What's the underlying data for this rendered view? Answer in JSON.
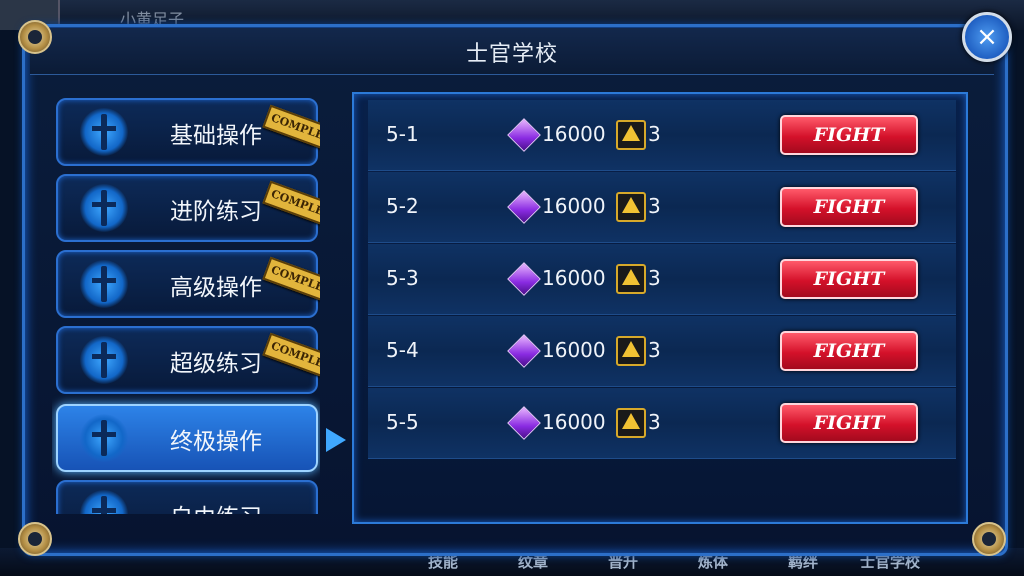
{
  "window": {
    "title": "士官学校"
  },
  "topbar": {
    "name": "小黄足子"
  },
  "categories": [
    {
      "label": "基础操作",
      "badge": "COMPLETE"
    },
    {
      "label": "进阶练习",
      "badge": "COMPLETE"
    },
    {
      "label": "高级操作",
      "badge": "COMPLETE"
    },
    {
      "label": "超级练习",
      "badge": "COMPLETE"
    },
    {
      "label": "终极操作",
      "badge": ""
    },
    {
      "label": "自由练习",
      "badge": ""
    }
  ],
  "stages": [
    {
      "id": "5-1",
      "cost": "16000",
      "stamina": "3",
      "button": "FIGHT"
    },
    {
      "id": "5-2",
      "cost": "16000",
      "stamina": "3",
      "button": "FIGHT"
    },
    {
      "id": "5-3",
      "cost": "16000",
      "stamina": "3",
      "button": "FIGHT"
    },
    {
      "id": "5-4",
      "cost": "16000",
      "stamina": "3",
      "button": "FIGHT"
    },
    {
      "id": "5-5",
      "cost": "16000",
      "stamina": "3",
      "button": "FIGHT"
    }
  ],
  "bottom_tabs": [
    "技能",
    "纹章",
    "晋升",
    "炼体",
    "羁绊",
    "士官学校"
  ],
  "icons": {
    "close": "close-icon",
    "crystal": "crystal-icon",
    "stamina": "stamina-icon",
    "arrow": "selected-arrow-icon"
  },
  "colors": {
    "accent": "#2c7ad8",
    "fight": "#d4112a",
    "stamp": "#e2b53c"
  }
}
